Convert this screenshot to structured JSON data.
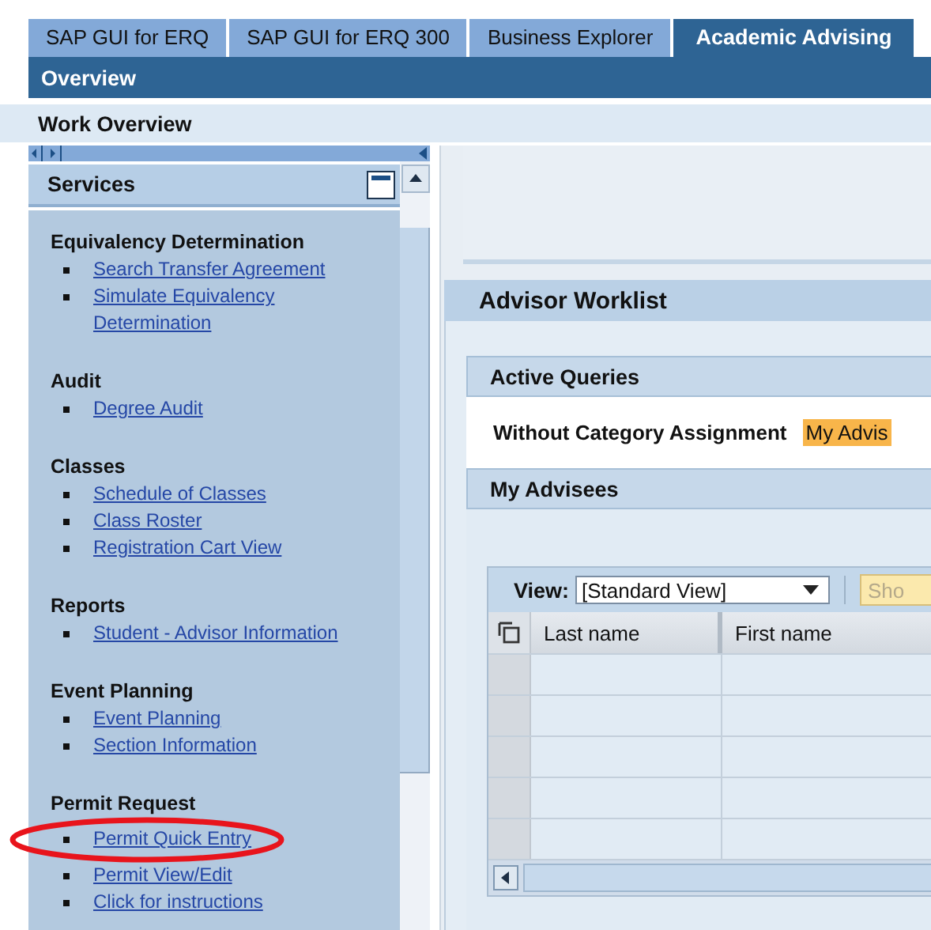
{
  "tabs": [
    {
      "label": "SAP GUI for ERQ",
      "selected": false
    },
    {
      "label": "SAP GUI for ERQ 300",
      "selected": false
    },
    {
      "label": "Business Explorer",
      "selected": false
    },
    {
      "label": "Academic Advising",
      "selected": true
    }
  ],
  "header_bar": "Overview",
  "subheader": "Work Overview",
  "sidebar": {
    "title": "Services",
    "sections": [
      {
        "title": "Equivalency Determination",
        "links": [
          "Search Transfer Agreement",
          "Simulate Equivalency Determination"
        ]
      },
      {
        "title": "Audit",
        "links": [
          "Degree Audit"
        ]
      },
      {
        "title": "Classes",
        "links": [
          "Schedule of Classes",
          "Class Roster",
          "Registration Cart View"
        ]
      },
      {
        "title": "Reports",
        "links": [
          "Student - Advisor Information"
        ]
      },
      {
        "title": "Event Planning",
        "links": [
          "Event Planning",
          "Section Information"
        ]
      },
      {
        "title": "Permit Request",
        "links": [
          "Permit Quick Entry",
          "Permit View/Edit",
          "Click for instructions"
        ]
      }
    ]
  },
  "worklist": {
    "title": "Advisor Worklist",
    "active_queries": {
      "title": "Active Queries",
      "label": "Without Category Assignment",
      "query": "My Advis"
    },
    "advisees": {
      "title": "My Advisees",
      "view_label": "View:",
      "view_value": "[Standard View]",
      "show_button": "Sho",
      "columns": [
        "Last name",
        "First name"
      ]
    }
  }
}
